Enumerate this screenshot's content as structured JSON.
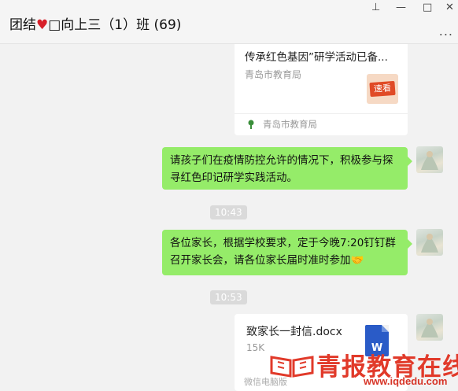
{
  "header": {
    "title_prefix": "团结",
    "title_suffix": "□向上三（1）班 (69)",
    "more_label": "..."
  },
  "window_controls": {
    "pin": "⊥",
    "minimize": "—",
    "maximize": "□",
    "close": "✕"
  },
  "article_card": {
    "title": "传承红色基因”研学活动已备...",
    "source": "青岛市教育局",
    "thumb_label": "速看",
    "footer_source": "青岛市教育局"
  },
  "messages": [
    {
      "text": "请孩子们在疫情防控允许的情况下，积极参与探寻红色印记研学实践活动。"
    },
    {
      "text": "各位家长，根据学校要求，定于今晚7:20钉钉群召开家长会，请各位家长届时准时参加🤝"
    }
  ],
  "timestamps": [
    "10:43",
    "10:53"
  ],
  "file_card": {
    "name": "致家长一封信.docx",
    "size": "15K",
    "icon_letter": "W",
    "footer": "微信电脑版"
  },
  "watermark": {
    "text": "青报教育在线",
    "url": "www.iqdedu.com"
  },
  "colors": {
    "bubble": "#95ec69",
    "background": "#f2f2f2",
    "watermark": "#e13a2a"
  }
}
